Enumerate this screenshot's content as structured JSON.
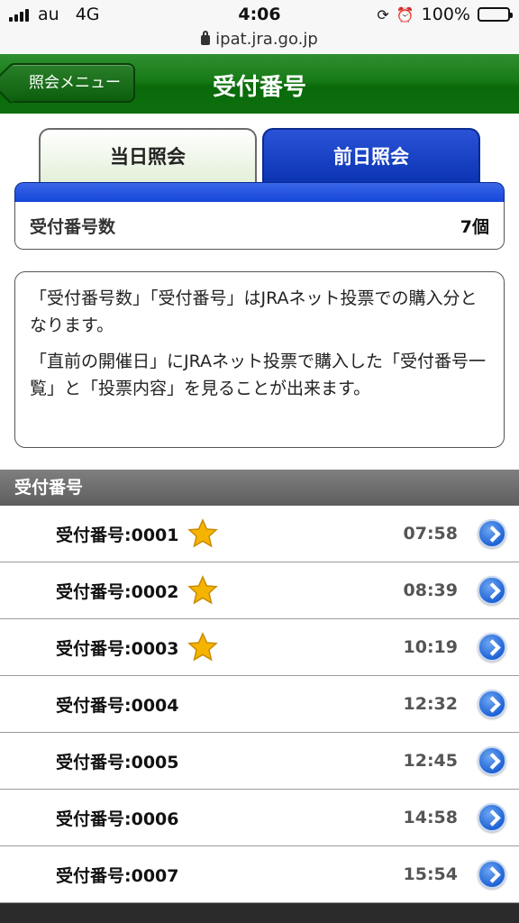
{
  "status_bar": {
    "carrier": "au",
    "network": "4G",
    "time": "4:06",
    "battery": "100%",
    "url": "ipat.jra.go.jp"
  },
  "header": {
    "back_label": "照会メニュー",
    "title": "受付番号"
  },
  "tabs": [
    {
      "label": "当日照会",
      "active": false
    },
    {
      "label": "前日照会",
      "active": true
    }
  ],
  "count": {
    "label": "受付番号数",
    "value": "7個"
  },
  "info": {
    "paragraph1": "「受付番号数」「受付番号」はJRAネット投票での購入分となります。",
    "paragraph2": "「直前の開催日」にJRAネット投票で購入した「受付番号一覧」と「投票内容」を見ることが出来ます。"
  },
  "section": {
    "title": "受付番号"
  },
  "receipts": [
    {
      "label": "受付番号:0001",
      "time": "07:58",
      "starred": true
    },
    {
      "label": "受付番号:0002",
      "time": "08:39",
      "starred": true
    },
    {
      "label": "受付番号:0003",
      "time": "10:19",
      "starred": true
    },
    {
      "label": "受付番号:0004",
      "time": "12:32",
      "starred": false
    },
    {
      "label": "受付番号:0005",
      "time": "12:45",
      "starred": false
    },
    {
      "label": "受付番号:0006",
      "time": "14:58",
      "starred": false
    },
    {
      "label": "受付番号:0007",
      "time": "15:54",
      "starred": false
    }
  ],
  "colors": {
    "header_green": "#167a16",
    "tab_blue": "#1446d8",
    "star": "#f5b400"
  }
}
